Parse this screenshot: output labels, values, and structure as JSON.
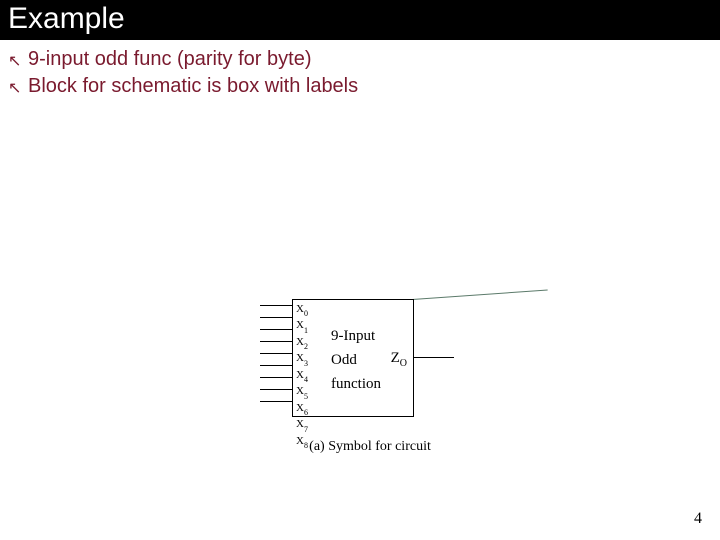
{
  "title": "Example",
  "bullets": [
    "9-input odd func (parity for byte)",
    "Block for schematic is box with labels"
  ],
  "diagram": {
    "pin_prefix": "X",
    "pin_indices": [
      "0",
      "1",
      "2",
      "3",
      "4",
      "5",
      "6",
      "7",
      "8"
    ],
    "box_line1": "9-Input",
    "box_line2": "Odd",
    "box_line3": "function",
    "output_label": "Z",
    "output_sub": "O",
    "caption": "(a) Symbol for circuit"
  },
  "page_number": "4"
}
